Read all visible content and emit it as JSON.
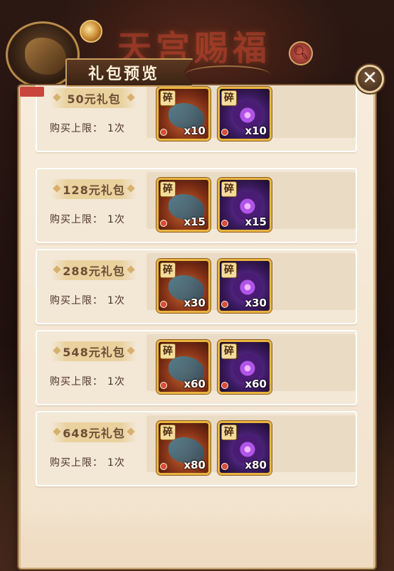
{
  "background": {
    "event_title": "天宫赐福"
  },
  "dialog": {
    "title": "礼包预览",
    "close_label": "✕"
  },
  "packages": [
    {
      "price": "50元礼包",
      "limit_label": "购买上限：",
      "limit_value": "1次",
      "items": [
        {
          "shard_label": "碎",
          "qty": "x10",
          "icon": "dragon-shard-icon"
        },
        {
          "shard_label": "碎",
          "qty": "x10",
          "icon": "spider-shard-icon"
        }
      ]
    },
    {
      "price": "128元礼包",
      "limit_label": "购买上限：",
      "limit_value": "1次",
      "items": [
        {
          "shard_label": "碎",
          "qty": "x15",
          "icon": "dragon-shard-icon"
        },
        {
          "shard_label": "碎",
          "qty": "x15",
          "icon": "spider-shard-icon"
        }
      ]
    },
    {
      "price": "288元礼包",
      "limit_label": "购买上限：",
      "limit_value": "1次",
      "items": [
        {
          "shard_label": "碎",
          "qty": "x30",
          "icon": "dragon-shard-icon"
        },
        {
          "shard_label": "碎",
          "qty": "x30",
          "icon": "spider-shard-icon"
        }
      ]
    },
    {
      "price": "548元礼包",
      "limit_label": "购买上限：",
      "limit_value": "1次",
      "items": [
        {
          "shard_label": "碎",
          "qty": "x60",
          "icon": "dragon-shard-icon"
        },
        {
          "shard_label": "碎",
          "qty": "x60",
          "icon": "spider-shard-icon"
        }
      ]
    },
    {
      "price": "648元礼包",
      "limit_label": "购买上限：",
      "limit_value": "1次",
      "items": [
        {
          "shard_label": "碎",
          "qty": "x80",
          "icon": "dragon-shard-icon"
        },
        {
          "shard_label": "碎",
          "qty": "x80",
          "icon": "spider-shard-icon"
        }
      ]
    }
  ],
  "colors": {
    "panel_bg": "#f7ecdc",
    "price_tag": "#ead29e",
    "item_frame": "#e9b43f",
    "ribbon": "#3b2314"
  }
}
